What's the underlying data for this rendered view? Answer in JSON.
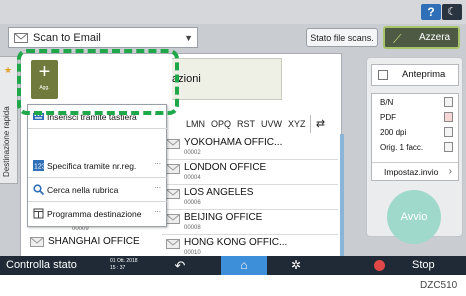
{
  "topbar": {
    "help_label": "?",
    "mode_icon": "moon-icon"
  },
  "destination_select": {
    "value": "Scan to Email"
  },
  "stato_file_label": "Stato file scans.",
  "azzera_label": "Azzera",
  "add_button": {
    "symbol": "+",
    "label": "Agg."
  },
  "specifica_label": "Specifica destinazioni",
  "side_tab_label": "Destinazione rapida",
  "list_tabs": [
    "LMN",
    "OPQ",
    "RST",
    "UVW",
    "XYZ"
  ],
  "popup_menu": [
    {
      "label": "Inserisci tramite tastiera",
      "icon": "keyboard-icon"
    },
    {
      "label": "Specifica tramite nr.reg.",
      "icon": "number-icon"
    },
    {
      "label": "Cerca nella rubrica",
      "icon": "search-icon"
    },
    {
      "label": "Programma destinazione",
      "icon": "program-destination-icon"
    }
  ],
  "destinations_right": [
    {
      "name": "YOKOHAMA OFFIC...",
      "num": "00002"
    },
    {
      "name": "LONDON OFFICE",
      "num": "00004"
    },
    {
      "name": "LOS ANGELES",
      "num": "00006"
    },
    {
      "name": "BEIJING OFFICE",
      "num": "00008"
    },
    {
      "name": "HONG KONG OFFIC...",
      "num": "00010"
    }
  ],
  "destinations_left": [
    {
      "name": "SHANGHAI OFFICE",
      "num": "00009"
    }
  ],
  "right_panel": {
    "anteprima": "Anteprima",
    "settings": [
      "B/N",
      "PDF",
      "200 dpi",
      "Orig. 1 facc."
    ],
    "impostaz": "Impostaz.invio"
  },
  "avvio_label": "Avvio",
  "bottom": {
    "controlla": "Controlla stato",
    "date": "01 Ott. 2018",
    "time": "15 : 37",
    "stop": "Stop"
  },
  "figure_code": "DZC510",
  "colors": {
    "accent": "#3c8fd8",
    "highlight_dash": "#1ea84a",
    "start": "#9fd9cc",
    "add": "#6f7a3c"
  }
}
